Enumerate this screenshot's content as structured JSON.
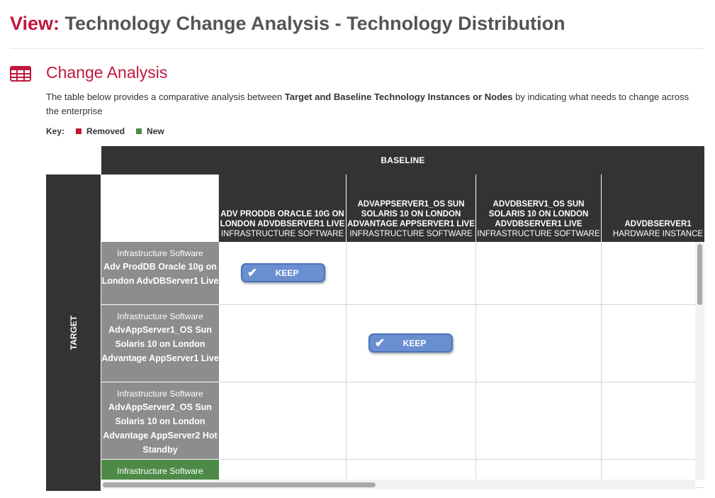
{
  "page": {
    "view_label": "View:",
    "view_title": "Technology Change Analysis - Technology Distribution"
  },
  "section": {
    "icon": "table-icon",
    "title": "Change Analysis",
    "desc_prefix": "The table below provides a comparative analysis between ",
    "desc_bold_1": "Target and Baseline",
    "desc_mid": " ",
    "desc_bold_2": "Technology Instances or Nodes",
    "desc_suffix": " by indicating what needs to change across the enterprise"
  },
  "key": {
    "label": "Key:",
    "items": [
      {
        "label": "Removed",
        "color": "#c0182c"
      },
      {
        "label": "New",
        "color": "#4d8a48"
      }
    ]
  },
  "baseline_label": "BASELINE",
  "target_label": "TARGET",
  "columns": [
    {
      "name": "Adv ProdDB Oracle 10g on London AdvDBServer1 Live",
      "type": "Infrastructure Software"
    },
    {
      "name": "AdvAppServer1_OS Sun Solaris 10 on London Advantage AppServer1 Live",
      "type": "Infrastructure Software"
    },
    {
      "name": "AdvDBServ1_OS Sun Solaris 10 on London AdvDBServer1 Live",
      "type": "Infrastructure Software"
    },
    {
      "name": "AdvDBServer1",
      "type": "Hardware Instance"
    }
  ],
  "rows": [
    {
      "type": "Infrastructure Software",
      "name": "Adv ProdDB Oracle 10g on London AdvDBServer1 Live",
      "status": ""
    },
    {
      "type": "Infrastructure Software",
      "name": "AdvAppServer1_OS Sun Solaris 10 on London Advantage AppServer1 Live",
      "status": ""
    },
    {
      "type": "Infrastructure Software",
      "name": "AdvAppServer2_OS Sun Solaris 10 on London Advantage AppServer2 Hot Standby",
      "status": ""
    },
    {
      "type": "Infrastructure Software",
      "name": "",
      "status": "new"
    }
  ],
  "keep_cells": [
    {
      "row": 0,
      "col": 0,
      "label": "KEEP",
      "icon": "check-icon"
    },
    {
      "row": 1,
      "col": 1,
      "label": "KEEP",
      "icon": "check-icon"
    }
  ]
}
